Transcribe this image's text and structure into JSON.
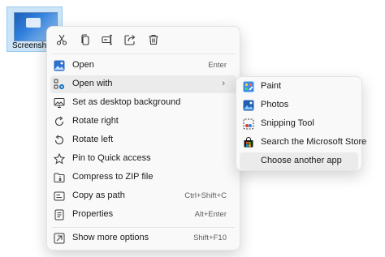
{
  "file": {
    "name": "Screenshot"
  },
  "quick_actions": [
    {
      "icon": "cut-icon"
    },
    {
      "icon": "copy-icon"
    },
    {
      "icon": "rename-icon"
    },
    {
      "icon": "share-icon"
    },
    {
      "icon": "delete-icon"
    }
  ],
  "menu": {
    "items": [
      {
        "label": "Open",
        "shortcut": "Enter",
        "icon": "open-image-icon"
      },
      {
        "label": "Open with",
        "shortcut": "",
        "icon": "open-with-icon"
      },
      {
        "label": "Set as desktop background",
        "shortcut": "",
        "icon": "desktop-background-icon"
      },
      {
        "label": "Rotate right",
        "shortcut": "",
        "icon": "rotate-right-icon"
      },
      {
        "label": "Rotate left",
        "shortcut": "",
        "icon": "rotate-left-icon"
      },
      {
        "label": "Pin to Quick access",
        "shortcut": "",
        "icon": "star-icon"
      },
      {
        "label": "Compress to ZIP file",
        "shortcut": "",
        "icon": "zip-folder-icon"
      },
      {
        "label": "Copy as path",
        "shortcut": "Ctrl+Shift+C",
        "icon": "copy-path-icon"
      },
      {
        "label": "Properties",
        "shortcut": "Alt+Enter",
        "icon": "properties-icon"
      },
      {
        "label": "Show more options",
        "shortcut": "Shift+F10",
        "icon": "more-options-icon"
      }
    ]
  },
  "submenu": {
    "items": [
      {
        "label": "Paint",
        "icon": "paint-app-icon"
      },
      {
        "label": "Photos",
        "icon": "photos-app-icon"
      },
      {
        "label": "Snipping Tool",
        "icon": "snipping-tool-icon"
      },
      {
        "label": "Search the Microsoft Store",
        "icon": "microsoft-store-icon"
      },
      {
        "label": "Choose another app",
        "icon": ""
      }
    ]
  },
  "colors": {
    "menu_bg": "#f9f9f9",
    "hover_bg": "#ebebeb",
    "selection_bg": "#cce4f7",
    "accent": "#0067c0"
  }
}
